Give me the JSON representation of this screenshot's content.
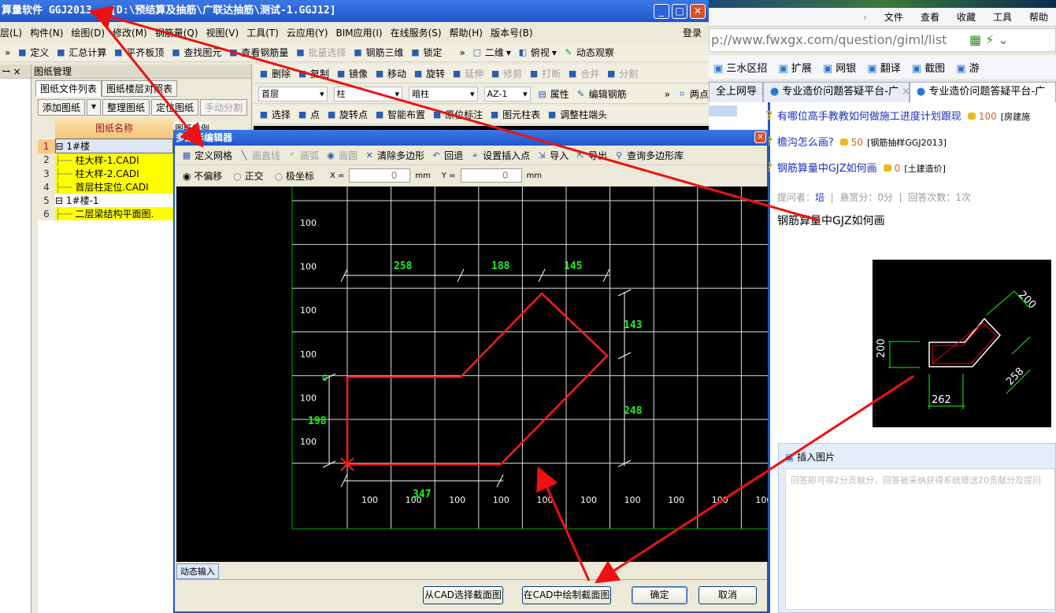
{
  "app": {
    "title": "算量软件 GGJ2013 - [D:\\预结算及抽筋\\广联达抽筋\\测试-1.GGJ12]",
    "menu": [
      "层(L)",
      "构件(N)",
      "绘图(D)",
      "修改(M)",
      "钢筋量(Q)",
      "视图(V)",
      "工具(T)",
      "云应用(Y)",
      "BIM应用(I)",
      "在线服务(S)",
      "帮助(H)",
      "版本号(B)"
    ],
    "login": "登录",
    "toolbar1": [
      "定义",
      "汇总计算",
      "平齐板顶",
      "查找图元",
      "查看钢筋量",
      "批量选择",
      "钢筋三维",
      "锁定"
    ],
    "view_2d": "二维",
    "view_top": "俯视",
    "dynamic_view": "动态观察",
    "edit_toolbar": [
      "删除",
      "复制",
      "镜像",
      "移动",
      "旋转",
      "延伸",
      "修剪",
      "打断",
      "合并",
      "分割"
    ],
    "selectors": [
      "首层",
      "柱",
      "暗柱",
      "AZ-1"
    ],
    "props": "属性",
    "edit_rebar": "编辑钢筋",
    "two_points": "两点",
    "draw_toolbar": [
      "选择",
      "点",
      "旋转点",
      "智能布置",
      "原位标注",
      "图元柱表",
      "调整柱端头"
    ]
  },
  "drawing_panel": {
    "title": "图纸管理",
    "tabs": [
      "图纸文件列表",
      "图纸楼层对照表"
    ],
    "buttons": [
      "添加图纸",
      "整理图纸",
      "定位图纸",
      "手动分割"
    ],
    "columns": [
      "图纸名称",
      "图纸比例"
    ],
    "rows": [
      {
        "num": "1",
        "name": "1#楼",
        "group": true,
        "highlight": false
      },
      {
        "num": "2",
        "name": "柱大样-1.CADI",
        "group": false,
        "highlight": true
      },
      {
        "num": "3",
        "name": "柱大样-2.CADI",
        "group": false,
        "highlight": true
      },
      {
        "num": "4",
        "name": "首层柱定位.CADI",
        "group": false,
        "highlight": true
      },
      {
        "num": "5",
        "name": "1#楼-1",
        "group": true,
        "highlight": false
      },
      {
        "num": "6",
        "name": "二层梁结构平面图.",
        "group": false,
        "highlight": true
      }
    ]
  },
  "browser": {
    "menu": [
      "文件",
      "查看",
      "收藏",
      "工具",
      "帮助"
    ],
    "url": "p://www.fwxgx.com/question/giml/list",
    "bookmarks": [
      "三水区招",
      "扩展",
      "网银",
      "翻译",
      "截图",
      "游"
    ],
    "tabs": [
      "全上网导",
      "专业造价问题答疑平台-广",
      "专业造价问题答疑平台-广"
    ],
    "questions": [
      {
        "title": "有哪位高手教教如何做施工进度计划跟现",
        "points": "100",
        "tag": "[房建施"
      },
      {
        "title": "檐沟怎么画?",
        "points": "50",
        "tag": "[钢筋抽样GGJ2013]"
      },
      {
        "title": "钢筋算量中GJZ如何画",
        "points": "0",
        "tag": "[土建造价]"
      }
    ],
    "meta": {
      "asker_label": "提问者：",
      "asker": "培",
      "reward": "悬赏分：0分",
      "answers": "回答次数：1次"
    },
    "question_body": "钢筋算量中GJZ如何画",
    "cad_dims": [
      "200",
      "200",
      "258",
      "262"
    ],
    "insert_image": "插入图片",
    "answer_placeholder": "回答即可得2分贡献分，回答被采纳获得系统赠送20贡献分及提问"
  },
  "dialog": {
    "title": "多边形编辑器",
    "toolbar": [
      {
        "label": "定义网格",
        "enabled": true,
        "icon": "grid-icon"
      },
      {
        "label": "画直线",
        "enabled": false,
        "icon": "line-icon"
      },
      {
        "label": "画弧",
        "enabled": false,
        "icon": "arc-icon"
      },
      {
        "label": "画圆",
        "enabled": false,
        "icon": "circle-icon"
      },
      {
        "label": "清除多边形",
        "enabled": true,
        "icon": "x-icon"
      },
      {
        "label": "回退",
        "enabled": true,
        "icon": "undo-icon"
      },
      {
        "label": "设置插入点",
        "enabled": true,
        "icon": "insert-point-icon"
      },
      {
        "label": "导入",
        "enabled": true,
        "icon": "import-icon"
      },
      {
        "label": "导出",
        "enabled": true,
        "icon": "export-icon"
      },
      {
        "label": "查询多边形库",
        "enabled": true,
        "icon": "search-icon"
      }
    ],
    "modes": [
      "不偏移",
      "正交",
      "极坐标"
    ],
    "selected_mode": "不偏移",
    "x_label": "X =",
    "x_value": "0",
    "y_label": "Y =",
    "y_value": "0",
    "unit": "mm",
    "grid_labels_left": [
      "100",
      "100",
      "100",
      "100",
      "100",
      "100"
    ],
    "grid_labels_bottom": [
      "100",
      "100",
      "100",
      "100",
      "100",
      "100",
      "100",
      "100",
      "100",
      "100"
    ],
    "origin_label": "0",
    "dims": {
      "top1": "258",
      "top2": "188",
      "top3": "145",
      "right1": "143",
      "right2": "248",
      "left": "198",
      "bottom": "347"
    },
    "dynamic_input": "动态输入",
    "buttons": [
      "从CAD选择截面图",
      "在CAD中绘制截面图",
      "确定",
      "取消"
    ]
  },
  "colors": {
    "grid": "#ffffff",
    "grid_axis": "#00aa00",
    "polygon": "#ff0000",
    "dim_text": "#00ff00",
    "annotation_arrow": "#ff0000"
  }
}
